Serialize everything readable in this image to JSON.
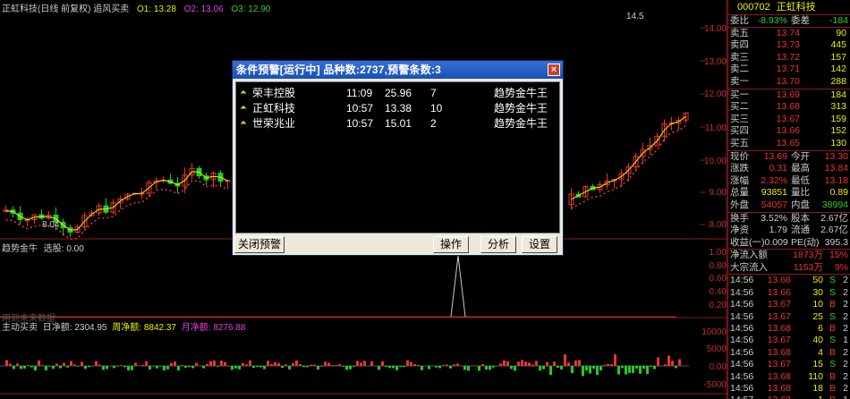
{
  "chart_header": {
    "title": "正虹科技(日线 前复权) 追风买卖",
    "o1": "O1: 13.28",
    "o2": "O2: 13.06",
    "o3": "O3: 12.90"
  },
  "main_chart": {
    "y_ticks": [
      "14.00",
      "13.00",
      "12.00",
      "11.00",
      "10.00",
      "9.00",
      "8.00"
    ],
    "low_annotation": "8.04",
    "high_annotation": "14.5"
  },
  "indicator1": {
    "label": "趋势金牛",
    "value": "选股: 0.00",
    "y_ticks": [
      "1.00",
      "0.80",
      "0.60",
      "0.40",
      "0.20"
    ],
    "footer": "用到未来数据"
  },
  "indicator2": {
    "label": "主动买卖",
    "day_net": "日净额: 2304.95",
    "week_net": "周净额: 8842.37",
    "month_net": "月净额: 8276.88",
    "y_ticks": [
      "10000",
      "5000",
      "0.00",
      "-5000"
    ]
  },
  "quote": {
    "code": "000702",
    "name": "正虹科技",
    "weibi_label": "委比",
    "weibi": "-8.93%",
    "weicha_label": "委差",
    "weicha": "-184",
    "asks": [
      {
        "label": "卖五",
        "price": "13.74",
        "vol": "90"
      },
      {
        "label": "卖四",
        "price": "13.73",
        "vol": "445"
      },
      {
        "label": "卖三",
        "price": "13.72",
        "vol": "157"
      },
      {
        "label": "卖二",
        "price": "13.71",
        "vol": "142"
      },
      {
        "label": "卖一",
        "price": "13.70",
        "vol": "288"
      }
    ],
    "bids": [
      {
        "label": "买一",
        "price": "13.69",
        "vol": "184"
      },
      {
        "label": "买二",
        "price": "13.68",
        "vol": "313"
      },
      {
        "label": "买三",
        "price": "13.67",
        "vol": "159"
      },
      {
        "label": "买四",
        "price": "13.66",
        "vol": "152"
      },
      {
        "label": "买五",
        "price": "13.65",
        "vol": "130"
      }
    ],
    "stats": [
      {
        "l1": "现价",
        "v1": "13.69",
        "c1": "#e33",
        "l2": "今开",
        "v2": "13.30",
        "c2": "#e33"
      },
      {
        "l1": "涨跌",
        "v1": "0.31",
        "c1": "#e33",
        "l2": "最高",
        "v2": "13.84",
        "c2": "#e33"
      },
      {
        "l1": "涨幅",
        "v1": "2.32%",
        "c1": "#e33",
        "l2": "最低",
        "v2": "13.18",
        "c2": "#e33"
      },
      {
        "l1": "总量",
        "v1": "93851",
        "c1": "#ee0",
        "l2": "量比",
        "v2": "0.89",
        "c2": "#ee0"
      },
      {
        "l1": "外盘",
        "v1": "54057",
        "c1": "#e33",
        "l2": "内盘",
        "v2": "38994",
        "c2": "#3c3"
      }
    ],
    "stats2": [
      {
        "l1": "换手",
        "v1": "3.52%",
        "l2": "股本",
        "v2": "2.67亿"
      },
      {
        "l1": "净资",
        "v1": "1.79",
        "l2": "流通",
        "v2": "2.67亿"
      },
      {
        "l1": "收益(一)",
        "v1": "0.009",
        "l2": "PE(动)",
        "v2": "395.3"
      }
    ],
    "flows": [
      {
        "label": "净流入额",
        "value": "1873万",
        "pct": "15%"
      },
      {
        "label": "大宗流入",
        "value": "1153万",
        "pct": "9%"
      }
    ],
    "ticks": [
      {
        "t": "14:56",
        "p": "13.66",
        "v": "50",
        "d": "S",
        "n": "2"
      },
      {
        "t": "14:56",
        "p": "13.66",
        "v": "30",
        "d": "S",
        "n": "2"
      },
      {
        "t": "14:56",
        "p": "13.67",
        "v": "10",
        "d": "B",
        "n": "2"
      },
      {
        "t": "14:56",
        "p": "13.67",
        "v": "25",
        "d": "S",
        "n": "2"
      },
      {
        "t": "14:56",
        "p": "13.68",
        "v": "6",
        "d": "B",
        "n": "2"
      },
      {
        "t": "14:56",
        "p": "13.67",
        "v": "40",
        "d": "S",
        "n": "1"
      },
      {
        "t": "14:56",
        "p": "13.68",
        "v": "4",
        "d": "B",
        "n": "2"
      },
      {
        "t": "14:56",
        "p": "13.67",
        "v": "15",
        "d": "S",
        "n": "2"
      },
      {
        "t": "14:56",
        "p": "13.68",
        "v": "110",
        "d": "B",
        "n": "2"
      },
      {
        "t": "14:56",
        "p": "13.68",
        "v": "18",
        "d": "B",
        "n": "2"
      },
      {
        "t": "14:57",
        "p": "13.69",
        "v": "1",
        "d": "B",
        "n": "1"
      }
    ]
  },
  "dialog": {
    "title": "条件预警[运行中] 品种数:2737,预警条数:3",
    "close_label": "×",
    "alerts": [
      {
        "name": "荣丰控股",
        "time": "11:09",
        "price": "25.96",
        "count": "7",
        "condition": "趋势金牛王"
      },
      {
        "name": "正虹科技",
        "time": "10:57",
        "price": "13.38",
        "count": "10",
        "condition": "趋势金牛王"
      },
      {
        "name": "世荣兆业",
        "time": "10:57",
        "price": "15.01",
        "count": "2",
        "condition": "趋势金牛王"
      }
    ],
    "buttons": {
      "close_alert": "关闭预警",
      "operate": "操作",
      "analyze": "分析",
      "settings": "设置"
    }
  }
}
